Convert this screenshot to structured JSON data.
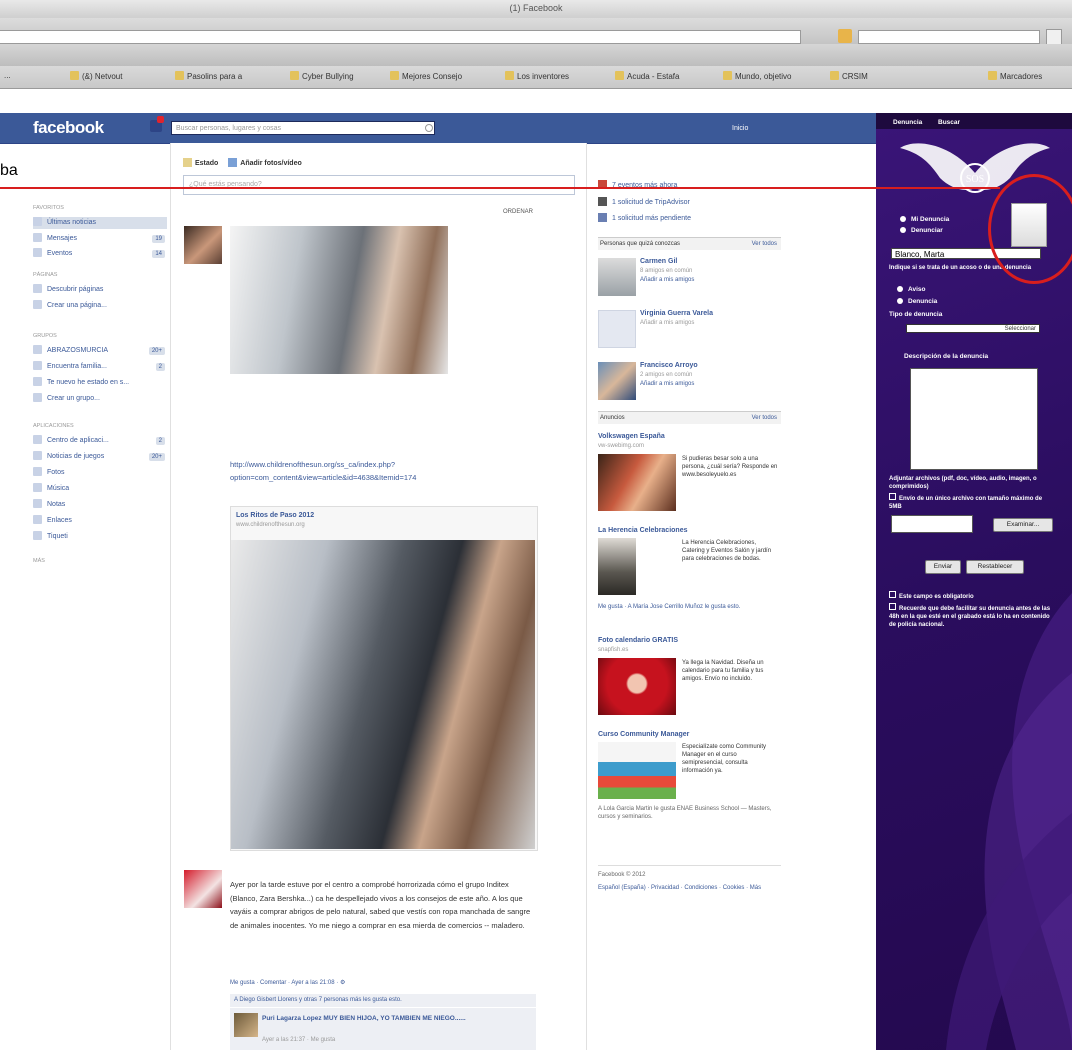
{
  "browser": {
    "window_title": "(1) Facebook",
    "bookmarks": [
      "...",
      "(&) Netvout",
      "Pasolins para a",
      "Cyber Bullying",
      "Mejores Consejo",
      "Los inventores",
      "Acuda - Estafa",
      "Mundo, objetivo",
      "CRSIM",
      "Marcadores"
    ]
  },
  "overlay": {
    "fragment_text": "ba"
  },
  "fb": {
    "logo": "facebook",
    "search_placeholder": "Buscar personas, lugares y cosas",
    "header_user": "Inicio",
    "nav": {
      "favorites_heading": "FAVORITOS",
      "favorites": [
        {
          "label": "Últimas noticias",
          "count": ""
        },
        {
          "label": "Mensajes",
          "count": "19"
        },
        {
          "label": "Eventos",
          "count": "14"
        }
      ],
      "pages_heading": "PÁGINAS",
      "pages": [
        {
          "label": "Descubrir páginas",
          "count": ""
        },
        {
          "label": "Crear una página...",
          "count": ""
        }
      ],
      "groups_heading": "GRUPOS",
      "groups": [
        {
          "label": "ABRAZOSMURCIA",
          "count": "20+"
        },
        {
          "label": "Encuentra familia...",
          "count": "2"
        },
        {
          "label": "Te nuevo he estado en s...",
          "count": ""
        },
        {
          "label": "Crear un grupo...",
          "count": ""
        }
      ],
      "apps_heading": "APLICACIONES",
      "apps": [
        {
          "label": "Centro de aplicaci...",
          "count": "2"
        },
        {
          "label": "Noticias de juegos",
          "count": "20+"
        },
        {
          "label": "Fotos",
          "count": ""
        },
        {
          "label": "Música",
          "count": ""
        },
        {
          "label": "Notas",
          "count": ""
        },
        {
          "label": "Enlaces",
          "count": ""
        },
        {
          "label": "Tiqueti",
          "count": ""
        }
      ],
      "more": "MÁS"
    },
    "composer": {
      "tab_status": "Estado",
      "tab_photo": "Añadir fotos/vídeo",
      "placeholder": "¿Qué estás pensando?",
      "sort": "ORDENAR"
    },
    "post1": {
      "link_url": "http://www.childrenofthesun.org/ss_ca/index.php?option=com_content&view=article&id=4638&Itemid=174",
      "share_title": "Los Ritos de Paso 2012",
      "share_domain": "www.childrenofthesun.org"
    },
    "post2": {
      "text": "Ayer por la tarde estuve por el centro a comprobé horrorizada cómo el grupo Inditex (Blanco, Zara Bershka...) ca he despellejado vivos a los consejos de este año. A los que vayáis a comprar abrigos de pelo natural, sabed que vestís con ropa manchada de sangre de animales inocentes. Yo me niego a comprar en esa mierda de comercios -- maladero.",
      "meta": "Me gusta · Comentar · Ayer a las 21:08 · ⚙",
      "likes": "A Diego Gisbert Llorens y otras 7 personas más les gusta esto.",
      "comment_text": "Puri Lagarza Lopez MUY BIEN HIJOA, YO TAMBIEN ME NIEGO......",
      "comment_meta": "Ayer a las 21:37 · Me gusta"
    },
    "right": {
      "requests": [
        "7 eventos más ahora",
        "1 solicitud de TripAdvisor",
        "1 solicitud más pendiente"
      ],
      "suggest_heading": "Personas que quizá conozcas",
      "see_all": "Ver todos",
      "suggestions": [
        {
          "name": "Carmen Gil",
          "sub": "8 amigos en común",
          "add": "Añadir a mis amigos"
        },
        {
          "name": "Virginia Guerra Varela",
          "sub": "",
          "add": "Añadir a mis amigos"
        },
        {
          "name": "Francisco Arroyo",
          "sub": "2 amigos en común",
          "add": "Añadir a mis amigos"
        }
      ],
      "ads_heading": "Anuncios",
      "ads": [
        {
          "title": "Volkswagen España",
          "sub": "vw-swebimg.com",
          "text": "Si pudieras besar solo a una persona, ¿cuál sería? Responde en www.besoleyuelo.es",
          "foot": ""
        },
        {
          "title": "La Herencia Celebraciones",
          "sub": "",
          "text": "La Herencia Celebraciones, Catering y Eventos Salón y jardín para celebraciones de bodas.",
          "foot": "Me gusta · A María Jose Cerrillo Muñoz le gusta esto."
        },
        {
          "title": "Foto calendario GRATIS",
          "sub": "snapfish.es",
          "text": "Ya llega la Navidad. Diseña un calendario para tu familia y tus amigos. Envío no incluido.",
          "foot": ""
        },
        {
          "title": "Curso Community Manager",
          "sub": "",
          "text": "Especialízate como Community Manager en el curso semipresencial, consulta información ya.",
          "foot": "A Lola Garcia Martin le gusta ENAE Business School — Masters, cursos y seminarios."
        }
      ],
      "footer": "Facebook © 2012",
      "footer_links": "Español (España) · Privacidad · Condiciones · Cookies · Más"
    }
  },
  "sos": {
    "tab1": "Denuncia",
    "tab2": "Buscar",
    "radio_mis": "Mi Denuncia",
    "radio_denunciar": "Denunciar",
    "selected_name": "Blanco, Marta",
    "indicate_label": "Indique si se trata de un acoso o de una denuncia",
    "opt_aviso": "Aviso",
    "opt_denuncia": "Denuncia",
    "tipo_label": "Tipo de denuncia",
    "tipo_select": "Seleccionar",
    "desc_label": "Descripción de la denuncia",
    "attach_label": "Adjuntar archivos (pdf, doc, vídeo, audio, imagen, o comprimidos)",
    "attach_note": "Envío de un único archivo con tamaño máximo de 5MB",
    "browse_btn": "Examinar...",
    "send_btn": "Enviar",
    "reset_btn": "Restablecer",
    "check1": "Este campo es obligatorio",
    "check2": "Recuerde que debe facilitar su denuncia antes de las 48h en la que esté en el grabado está lo ha en contenido de policía nacional."
  }
}
